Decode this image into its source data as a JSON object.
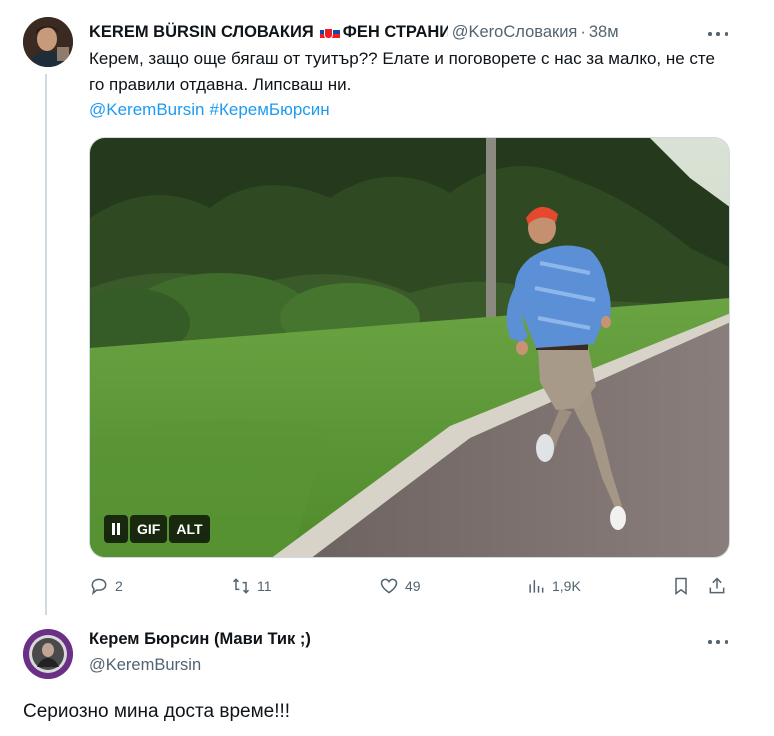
{
  "tweet1": {
    "author_name": "KEREM BÜRSIN СЛОВАКИЯ",
    "author_name_suffix": "ФЕН СТРАНИЦА",
    "flag_icon": "slovakia-flag-icon",
    "handle": "@KeroСловакия",
    "separator": "·",
    "time": "38м",
    "text": "Керем, защо още бягаш от туитър?? Елате и поговорете с нас за малко, не сте го правили отдавна. Липсваш ни.",
    "mention": "@KeremBursin",
    "hashtag": "#КеремБюрсин",
    "media": {
      "pause_icon": "pause-icon",
      "gif_label": "GIF",
      "alt_label": "ALT"
    },
    "actions": {
      "reply_count": "2",
      "retweet_count": "11",
      "like_count": "49",
      "views_count": "1,9K"
    }
  },
  "tweet2": {
    "author_name": "Керем Бюрсин (Мави Тик ;)",
    "handle": "@KeremBursin",
    "text": "Сериозно мина доста време!!!"
  },
  "colors": {
    "accent": "#1d9bf0",
    "muted": "#536471",
    "border": "#cfd9de"
  }
}
